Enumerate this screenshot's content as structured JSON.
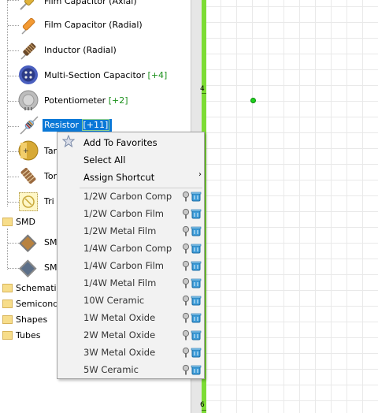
{
  "tree": {
    "components": [
      {
        "label": "Film Capacitor (Axial)",
        "count": "",
        "icon": "film-capacitor-axial-icon"
      },
      {
        "label": "Film Capacitor (Radial)",
        "count": "",
        "icon": "film-capacitor-radial-icon"
      },
      {
        "label": "Inductor (Radial)",
        "count": "",
        "icon": "inductor-radial-icon"
      },
      {
        "label": "Multi-Section Capacitor",
        "count": "[+4]",
        "icon": "multi-section-capacitor-icon"
      },
      {
        "label": "Potentiometer",
        "count": "[+2]",
        "icon": "potentiometer-icon"
      },
      {
        "label": "Resistor",
        "count": "[+11]",
        "icon": "resistor-icon",
        "selected": true
      },
      {
        "label": "Tar",
        "count": "",
        "icon": "tantalum-capacitor-icon"
      },
      {
        "label": "Tor",
        "count": "",
        "icon": "toroid-icon"
      },
      {
        "label": "Tri",
        "count": "",
        "icon": "trimmer-icon"
      }
    ],
    "smd_folder": "SMD",
    "smd_items": [
      "SM",
      "SM"
    ],
    "folders": [
      "Schematic",
      "Semicondu",
      "Shapes",
      "Tubes"
    ]
  },
  "canvas": {
    "ruler_labels": [
      "4",
      "6"
    ],
    "accent": "#7cdc34"
  },
  "menu": {
    "add_favorites": "Add To Favorites",
    "select_all": "Select All",
    "assign_shortcut": "Assign Shortcut",
    "submenu_arrow": "›",
    "variants": [
      "1/2W Carbon Comp",
      "1/2W Carbon Film",
      "1/2W Metal Film",
      "1/4W Carbon Comp",
      "1/4W Carbon Film",
      "1/4W Metal Film",
      "10W Ceramic",
      "1W Metal Oxide",
      "2W Metal Oxide",
      "3W Metal Oxide",
      "5W Ceramic"
    ]
  }
}
